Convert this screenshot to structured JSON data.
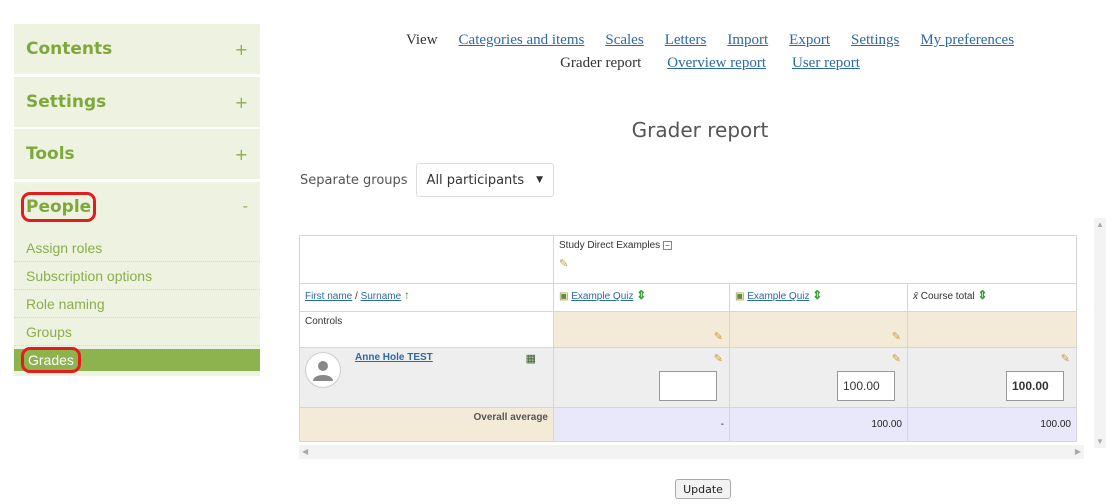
{
  "sidebar": {
    "sections": [
      {
        "label": "Contents",
        "toggle": "+"
      },
      {
        "label": "Settings",
        "toggle": "+"
      },
      {
        "label": "Tools",
        "toggle": "+"
      }
    ],
    "people": {
      "label": "People",
      "toggle": "-",
      "items": [
        "Assign roles",
        "Subscription options",
        "Role naming",
        "Groups",
        "Grades"
      ],
      "active_item": "Grades"
    }
  },
  "topnav": {
    "row1": [
      {
        "label": "View",
        "current": true
      },
      {
        "label": "Categories and items"
      },
      {
        "label": "Scales"
      },
      {
        "label": "Letters"
      },
      {
        "label": "Import"
      },
      {
        "label": "Export"
      },
      {
        "label": "Settings"
      },
      {
        "label": "My preferences"
      }
    ],
    "row2": [
      {
        "label": "Grader report",
        "current": true
      },
      {
        "label": "Overview report"
      },
      {
        "label": "User report"
      }
    ]
  },
  "page_title": "Grader report",
  "groups": {
    "label": "Separate groups",
    "selected": "All participants"
  },
  "table": {
    "category": "Study Direct Examples",
    "col_first": "First name",
    "col_sep": " / ",
    "col_surname": "Surname",
    "columns": [
      "Example Quiz",
      "Example Quiz",
      "Course total"
    ],
    "controls": "Controls",
    "student": {
      "name": "Anne Hole TEST",
      "grades": [
        "",
        "100.00",
        "100.00"
      ]
    },
    "overall_label": "Overall average",
    "overall_values": [
      "-",
      "100.00",
      "100.00"
    ]
  },
  "update_button": "Update"
}
